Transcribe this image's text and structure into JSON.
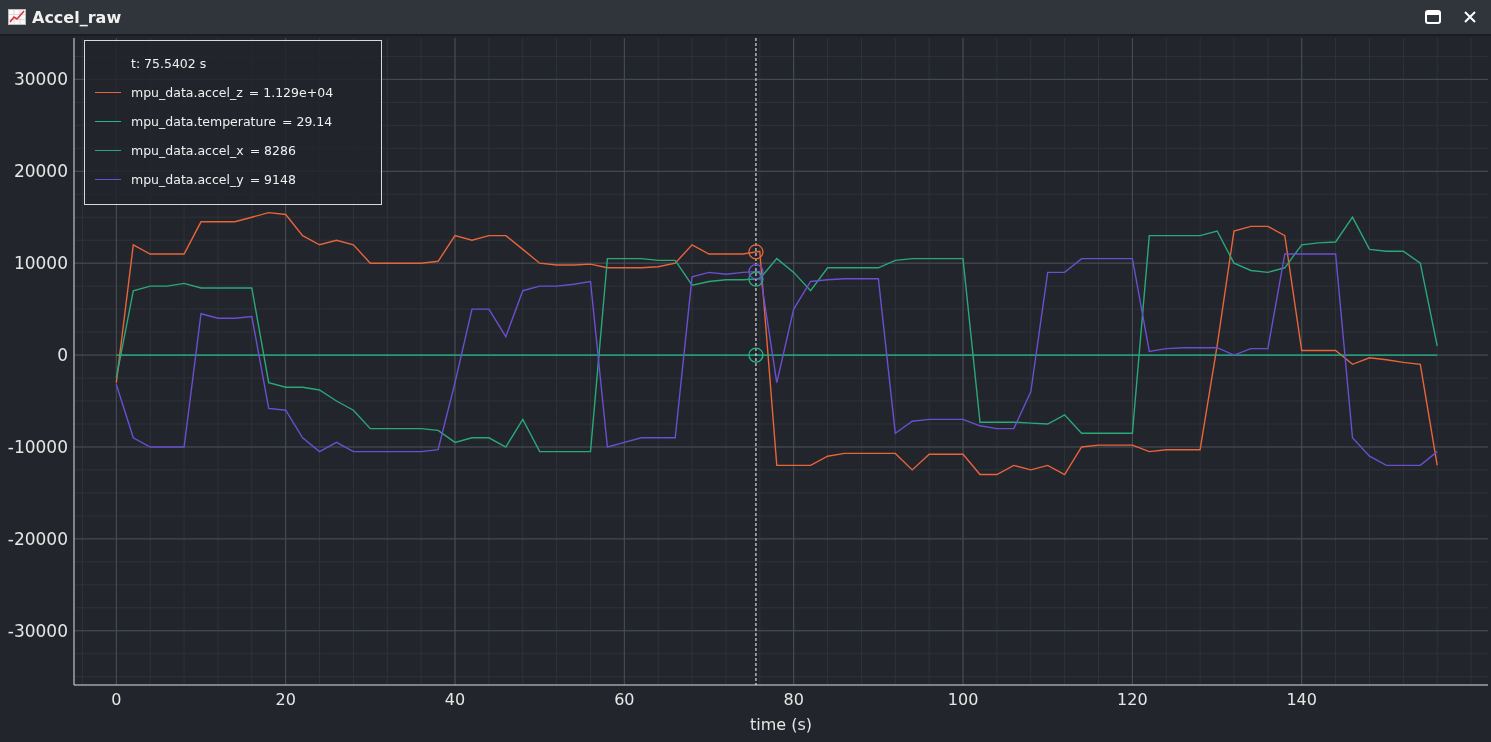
{
  "window": {
    "title": "Accel_raw"
  },
  "plot": {
    "legend": {
      "time": "t: 75.5402 s",
      "items": [
        {
          "value": "= 1.129e+04"
        },
        {
          "value": "= 29.14"
        },
        {
          "value": "= 8286"
        },
        {
          "value": "= 9148"
        }
      ]
    },
    "chart_data": {
      "type": "line",
      "grid": true,
      "xlabel": "time (s)",
      "xlim": [
        -5,
        162
      ],
      "ylim": [
        -35900,
        34500
      ],
      "xticks": [
        0,
        20,
        40,
        60,
        80,
        100,
        120,
        140
      ],
      "yticks": [
        -30000,
        -20000,
        -10000,
        0,
        10000,
        20000,
        30000
      ],
      "legend": "upper left",
      "ref_lines": [
        {
          "axis": "x",
          "value": 75.5402
        }
      ],
      "x": [
        0,
        2,
        4,
        6,
        8,
        10,
        12,
        14,
        16,
        18,
        20,
        22,
        24,
        26,
        28,
        30,
        32,
        34,
        36,
        38,
        40,
        42,
        44,
        46,
        48,
        50,
        52,
        54,
        56,
        58,
        60,
        62,
        64,
        66,
        68,
        70,
        72,
        74,
        76,
        78,
        80,
        82,
        84,
        86,
        88,
        90,
        92,
        94,
        96,
        98,
        100,
        102,
        104,
        106,
        108,
        110,
        112,
        114,
        116,
        118,
        120,
        122,
        124,
        126,
        128,
        130,
        132,
        134,
        136,
        138,
        140,
        142,
        144,
        146,
        148,
        150,
        152,
        154,
        156
      ],
      "series": [
        {
          "name": "mpu_data.accel_z",
          "color": "#e8643a",
          "values": [
            -3000,
            12000,
            11000,
            11000,
            11000,
            14500,
            14500,
            14500,
            15000,
            15500,
            15300,
            13000,
            12000,
            12500,
            12000,
            10000,
            10000,
            10000,
            10000,
            10200,
            13000,
            12500,
            13000,
            13000,
            11500,
            10000,
            9800,
            9800,
            9900,
            9500,
            9500,
            9500,
            9600,
            10000,
            12000,
            11000,
            11000,
            11000,
            11300,
            -12000,
            -12000,
            -12000,
            -11000,
            -10700,
            -10700,
            -10700,
            -10700,
            -12500,
            -10800,
            -10800,
            -10800,
            -13000,
            -13000,
            -12000,
            -12500,
            -12000,
            -13000,
            -10000,
            -9800,
            -9800,
            -9800,
            -10500,
            -10300,
            -10300,
            -10300,
            1000,
            13500,
            14000,
            14000,
            13000,
            500,
            500,
            500,
            -1000,
            -300,
            -500,
            -800,
            -1000,
            -12000
          ]
        },
        {
          "name": "mpu_data.temperature",
          "color": "#1fb98a",
          "values": [
            0,
            0,
            0,
            0,
            0,
            0,
            0,
            0,
            0,
            0,
            0,
            0,
            0,
            0,
            0,
            0,
            0,
            0,
            0,
            0,
            0,
            0,
            0,
            0,
            0,
            0,
            0,
            0,
            0,
            0,
            0,
            0,
            0,
            0,
            0,
            0,
            0,
            0,
            0,
            0,
            0,
            0,
            0,
            0,
            0,
            0,
            0,
            0,
            0,
            0,
            0,
            0,
            0,
            0,
            0,
            0,
            0,
            0,
            0,
            0,
            0,
            0,
            0,
            0,
            0,
            0,
            0,
            0,
            0,
            0,
            0,
            0,
            0,
            0,
            0,
            0,
            0,
            0,
            0
          ]
        },
        {
          "name": "mpu_data.accel_x",
          "color": "#2aa879",
          "values": [
            -2500,
            7000,
            7500,
            7500,
            7800,
            7300,
            7300,
            7300,
            7300,
            -3000,
            -3500,
            -3500,
            -3800,
            -5000,
            -6000,
            -8000,
            -8000,
            -8000,
            -8000,
            -8200,
            -9500,
            -9000,
            -9000,
            -10000,
            -7000,
            -10500,
            -10500,
            -10500,
            -10500,
            10500,
            10500,
            10500,
            10300,
            10300,
            7600,
            8000,
            8200,
            8200,
            8300,
            10500,
            9000,
            7000,
            9500,
            9500,
            9500,
            9500,
            10300,
            10500,
            10500,
            10500,
            10500,
            -7300,
            -7300,
            -7300,
            -7400,
            -7500,
            -6500,
            -8500,
            -8500,
            -8500,
            -8500,
            13000,
            13000,
            13000,
            13000,
            13500,
            10000,
            9200,
            9000,
            9500,
            12000,
            12200,
            12300,
            15000,
            11500,
            11300,
            11300,
            10000,
            1000
          ]
        },
        {
          "name": "mpu_data.accel_y",
          "color": "#6a4fd0",
          "values": [
            -3200,
            -9000,
            -10000,
            -10000,
            -10000,
            4500,
            4000,
            4000,
            4200,
            -5800,
            -6000,
            -9000,
            -10500,
            -9500,
            -10500,
            -10500,
            -10500,
            -10500,
            -10500,
            -10300,
            -3000,
            5000,
            5000,
            2000,
            7000,
            7500,
            7500,
            7700,
            8000,
            -10000,
            -9500,
            -9000,
            -9000,
            -9000,
            8500,
            9000,
            8800,
            9000,
            9100,
            -3000,
            5000,
            8000,
            8200,
            8300,
            8300,
            8300,
            -8500,
            -7200,
            -7000,
            -7000,
            -7000,
            -7700,
            -8000,
            -8000,
            -4000,
            9000,
            9000,
            10500,
            10500,
            10500,
            10500,
            400,
            700,
            800,
            800,
            800,
            0,
            700,
            700,
            11000,
            11000,
            11000,
            11000,
            -9000,
            -11000,
            -12000,
            -12000,
            -12000,
            -10500
          ]
        }
      ]
    }
  }
}
